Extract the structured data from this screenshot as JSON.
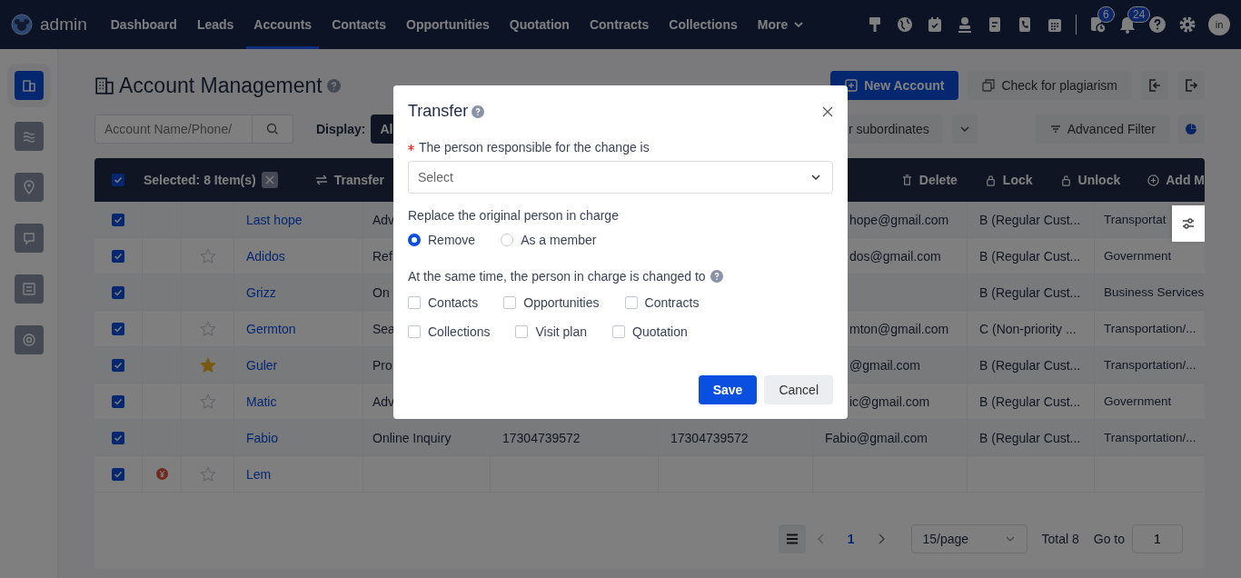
{
  "topbar": {
    "brand": "admin",
    "nav": [
      {
        "label": "Dashboard",
        "selected": false,
        "kind": "link"
      },
      {
        "label": "Leads",
        "selected": false,
        "kind": "link"
      },
      {
        "label": "Accounts",
        "selected": true,
        "kind": "link"
      },
      {
        "label": "Contacts",
        "selected": false,
        "kind": "link"
      },
      {
        "label": "Opportunities",
        "selected": false,
        "kind": "link"
      },
      {
        "label": "Quotation",
        "selected": false,
        "kind": "link"
      },
      {
        "label": "Contracts",
        "selected": false,
        "kind": "link"
      },
      {
        "label": "Collections",
        "selected": false,
        "kind": "link"
      },
      {
        "label": "More",
        "selected": false,
        "kind": "menu"
      }
    ],
    "task_badge": "6",
    "notification_badge": "24",
    "avatar": "in"
  },
  "sidebar": {
    "items": [
      {
        "selected": true
      },
      {
        "selected": false
      },
      {
        "selected": false
      },
      {
        "selected": false
      },
      {
        "selected": false
      },
      {
        "selected": false
      }
    ]
  },
  "page": {
    "title": "Account Management",
    "actions": [
      "New Account",
      "Check for plagiarism"
    ],
    "search": {
      "placeholder": "Account Name/Phone/"
    },
    "display_label": "Display:",
    "display_options": [
      {
        "label": "Al",
        "selected": true
      },
      {
        "label": "r subordinates",
        "selected": false
      }
    ],
    "advanced_filter": "Advanced Filter"
  },
  "batch_bar": {
    "checked": true,
    "selected_text": "Selected: 8 Item(s)",
    "actions": [
      "Transfer",
      "Delete",
      "Lock",
      "Unlock",
      "Add M"
    ]
  },
  "table": {
    "rows": [
      {
        "checked": true,
        "name": "Last hope",
        "source": "Adv",
        "email": "hope@gmail.com",
        "email_partly_hidden": true,
        "level": "B (Regular Cust...",
        "industry": "Transportat"
      },
      {
        "checked": true,
        "starred": false,
        "name": "Adidos",
        "source": "Ref",
        "email": "dos@gmail.com",
        "email_partly_hidden": true,
        "level": "B (Regular Cust...",
        "industry": "Government"
      },
      {
        "checked": true,
        "name": "Grizz",
        "source": "On",
        "level": "B (Regular Cust...",
        "industry": "Business Services"
      },
      {
        "checked": true,
        "starred": false,
        "name": "Germton",
        "source": "Sea",
        "email": "mton@gmail.com",
        "email_partly_hidden": true,
        "level": "C (Non-priority ...",
        "industry": "Transportation/..."
      },
      {
        "checked": true,
        "starred": true,
        "name": "Guler",
        "source": "Pro",
        "email": "@gmail.com",
        "email_partly_hidden": true,
        "level": "B (Regular Cust...",
        "industry": "Transportation/..."
      },
      {
        "checked": true,
        "starred": false,
        "name": "Matic",
        "source": "Adv",
        "email": "ic@gmail.com",
        "email_partly_hidden": true,
        "level": "B (Regular Cust...",
        "industry": "Government"
      },
      {
        "checked": true,
        "name": "Fabio",
        "source": "Online Inquiry",
        "phone": "17304739572",
        "phone_2": "17304739572",
        "email": "Fabio@gmail.com",
        "email_partly_hidden": false,
        "level": "B (Regular Cust...",
        "industry": "Transportation/..."
      },
      {
        "checked": true,
        "coin": true,
        "starred": false,
        "name": "Lem"
      }
    ]
  },
  "pagination": {
    "pages": [
      {
        "label": "1",
        "selected": true
      }
    ],
    "page_size": "15/page",
    "total": "Total 8",
    "goto_label": "Go to",
    "goto_value": "1"
  },
  "dialog": {
    "title": "Transfer",
    "field_label": "The person responsible for the change is",
    "required": true,
    "select_placeholder": "Select",
    "replace_label": "Replace the original person in charge",
    "radios": [
      {
        "label": "Remove",
        "selected": true
      },
      {
        "label": "As a member",
        "selected": false
      }
    ],
    "also_label": "At the same time, the person in charge is changed to",
    "checkboxes": [
      [
        {
          "label": "Contacts",
          "checked": false
        },
        {
          "label": "Opportunities",
          "checked": false
        },
        {
          "label": "Contracts",
          "checked": false
        }
      ],
      [
        {
          "label": "Collections",
          "checked": false
        },
        {
          "label": "Visit plan",
          "checked": false
        },
        {
          "label": "Quotation",
          "checked": false
        }
      ]
    ],
    "buttons": [
      {
        "label": "Save",
        "kind": "primary"
      },
      {
        "label": "Cancel",
        "kind": "secondary"
      }
    ]
  }
}
